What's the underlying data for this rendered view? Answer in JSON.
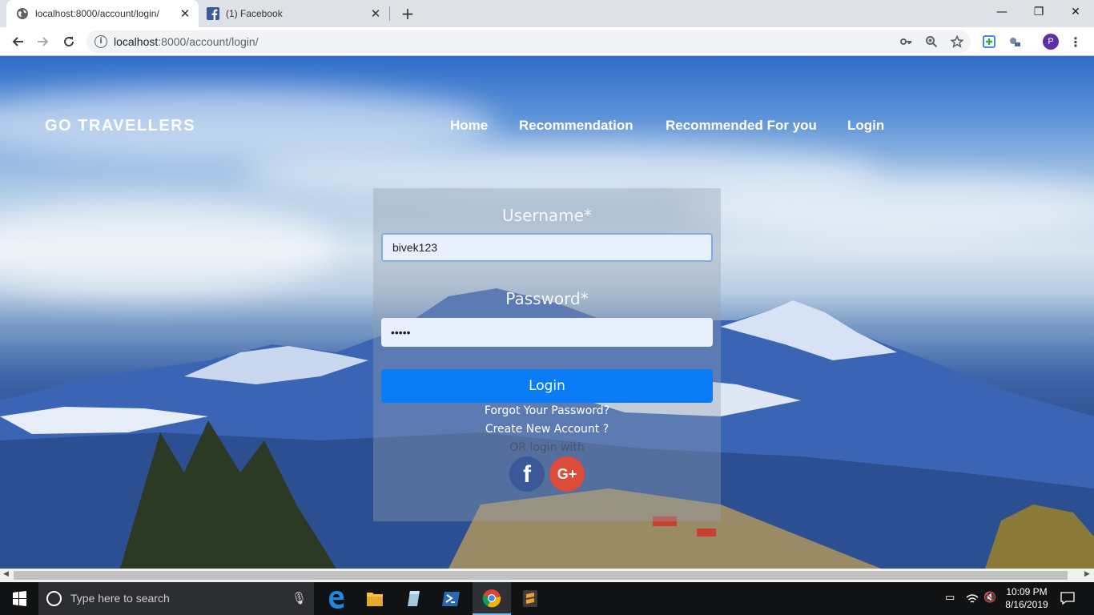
{
  "browser": {
    "tabs": [
      {
        "title": "localhost:8000/account/login/",
        "active": true,
        "favicon": "globe-icon"
      },
      {
        "title": "(1) Facebook",
        "active": false,
        "favicon": "facebook-icon"
      }
    ],
    "url_host": "localhost",
    "url_rest": ":8000/account/login/",
    "profile_initial": "P",
    "window_controls": {
      "minimize": "—",
      "restore": "❐",
      "close": "✕"
    }
  },
  "site": {
    "brand": "GO TRAVELLERS",
    "nav": [
      "Home",
      "Recommendation",
      "Recommended For you",
      "Login"
    ]
  },
  "login_form": {
    "username_label": "Username*",
    "username_value": "bivek123",
    "password_label": "Password*",
    "password_value": "•••••",
    "submit_label": "Login",
    "forgot_link": "Forgot Your Password?",
    "create_link": "Create New Account ?",
    "or_text": "OR login with",
    "social": {
      "facebook": "f",
      "google": "G+"
    }
  },
  "taskbar": {
    "search_placeholder": "Type here to search",
    "time": "10:09 PM",
    "date": "8/16/2019"
  },
  "colors": {
    "accent": "#0a7cf6",
    "facebook": "#3b5998",
    "google": "#dd4b39",
    "profile": "#5b2fa5"
  }
}
